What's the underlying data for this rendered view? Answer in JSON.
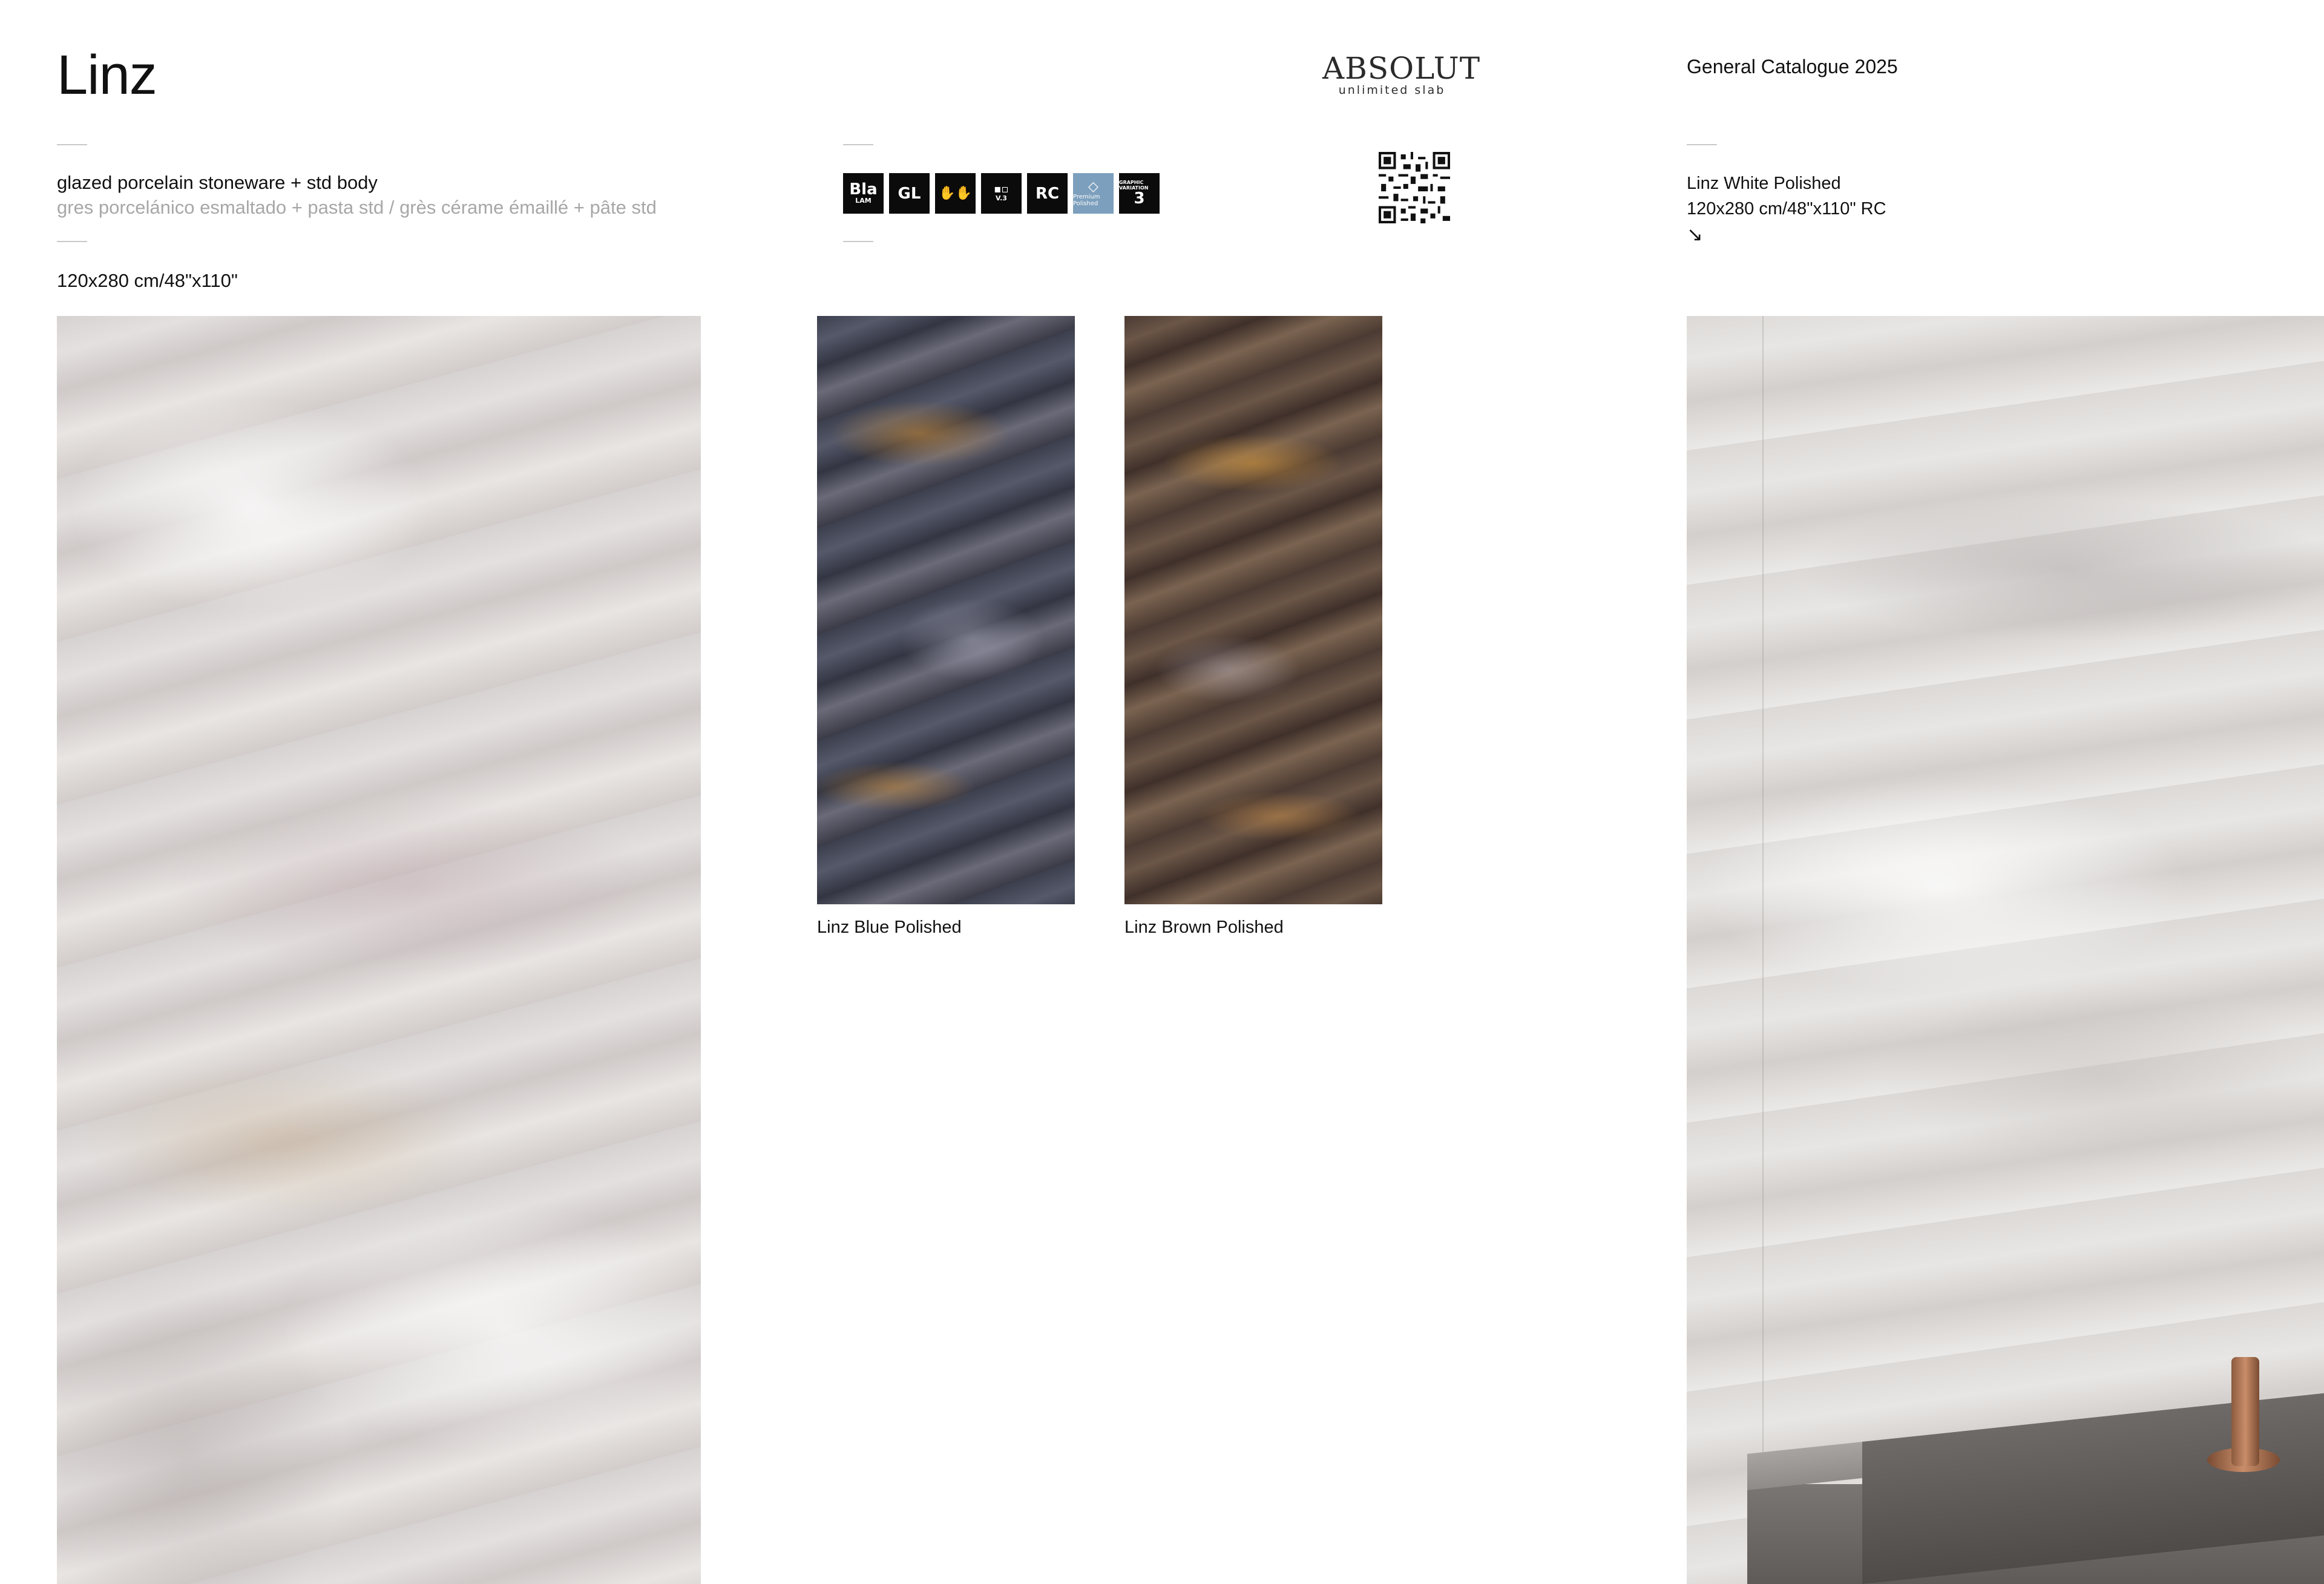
{
  "header": {
    "title": "Linz",
    "logo": {
      "main": "ABSOLUT",
      "sub": "unlimited slab"
    },
    "catalogue": "General Catalogue 2025"
  },
  "product": {
    "material_en": "glazed porcelain stoneware + std body",
    "material_translations": "gres porcelánico esmaltado + pasta std / grès cérame émaillé + pâte std",
    "format": "120x280 cm/48\"x110\""
  },
  "badges": [
    {
      "big": "Bla",
      "small": "LAM",
      "icon": "bla-lam-icon"
    },
    {
      "big": "GL",
      "small": "",
      "icon": "gl-icon"
    },
    {
      "big": "✋✋",
      "small": "",
      "icon": "hands-icon"
    },
    {
      "big": "▪▫",
      "small": "V.3",
      "icon": "v3-variation-icon"
    },
    {
      "big": "RC",
      "small": "",
      "icon": "rc-icon"
    },
    {
      "big": "◇",
      "small": "Premium Polished",
      "icon": "premium-polished-icon"
    },
    {
      "big": "3",
      "small": "GRAPHIC VARIATION",
      "icon": "graphic-variation-icon"
    }
  ],
  "colors": {
    "badge_bg": "#0b0b0b",
    "badge_premium": "#7c9fbd",
    "secondary_text": "#a7a7a7",
    "rule": "#c9c9c9"
  },
  "featured": {
    "name": "Linz White Polished",
    "size": "120x280 cm/48\"x110\" RC",
    "arrow": "↘"
  },
  "variants": [
    {
      "caption": "Linz Blue Polished"
    },
    {
      "caption": "Linz Brown Polished"
    }
  ]
}
